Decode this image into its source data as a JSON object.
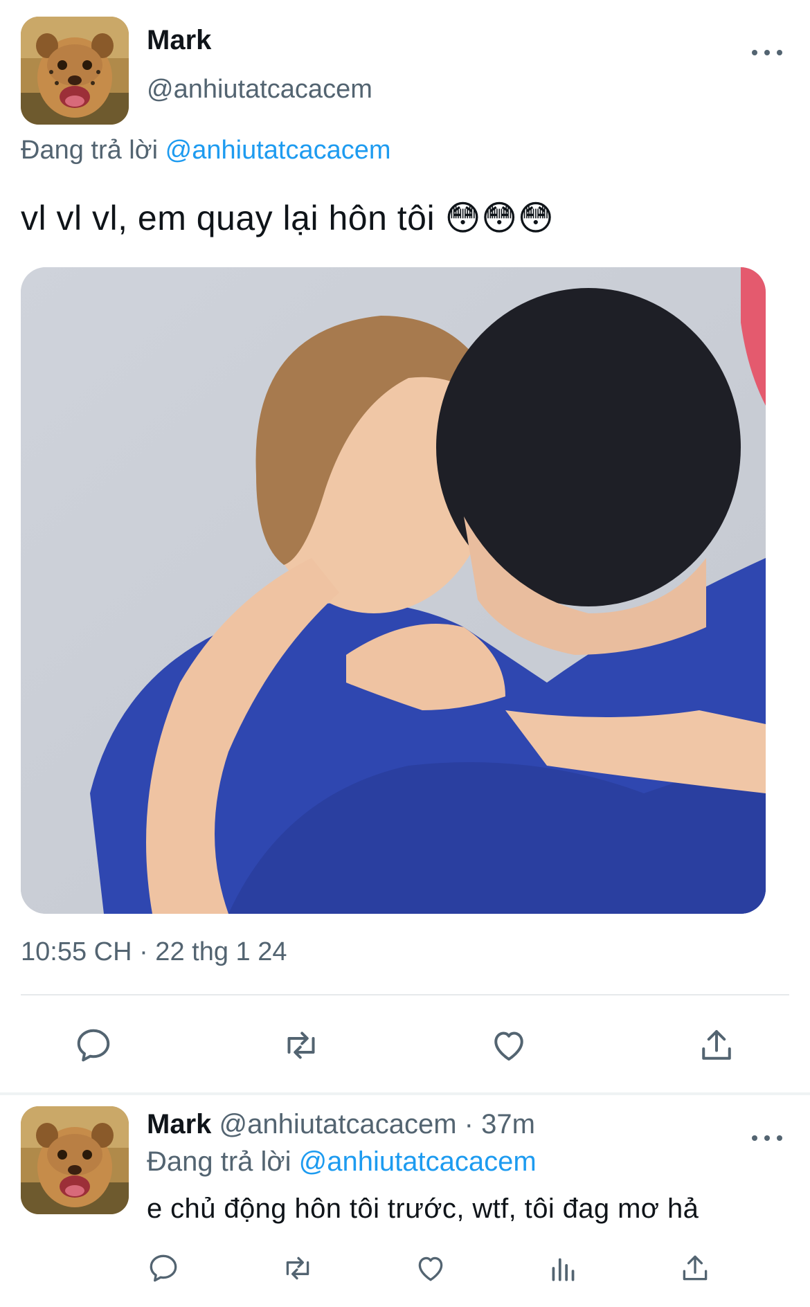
{
  "main_tweet": {
    "display_name": "Mark",
    "handle": "@anhiutatcacacem",
    "reply_prefix": "Đang trả lời",
    "reply_to": "@anhiutatcacacem",
    "text": "vl vl vl, em quay lại hôn tôi 😳😳😳",
    "timestamp": "10:55 CH · 22 thg 1 24",
    "actions": [
      "reply-icon",
      "retweet-icon",
      "like-icon",
      "share-icon"
    ]
  },
  "reply_tweet": {
    "display_name": "Mark",
    "handle": "@anhiutatcacacem",
    "separator": "·",
    "time": "37m",
    "reply_prefix": "Đang trả lời",
    "reply_to": "@anhiutatcacacem",
    "text": "e chủ động hôn tôi trước, wtf, tôi đag mơ hả",
    "actions": [
      "reply-icon",
      "retweet-icon",
      "like-icon",
      "views-icon",
      "share-icon"
    ]
  },
  "colors": {
    "text_primary": "#0f1419",
    "text_secondary": "#536471",
    "accent": "#1d9bf0",
    "divider": "#e6e9eb"
  }
}
